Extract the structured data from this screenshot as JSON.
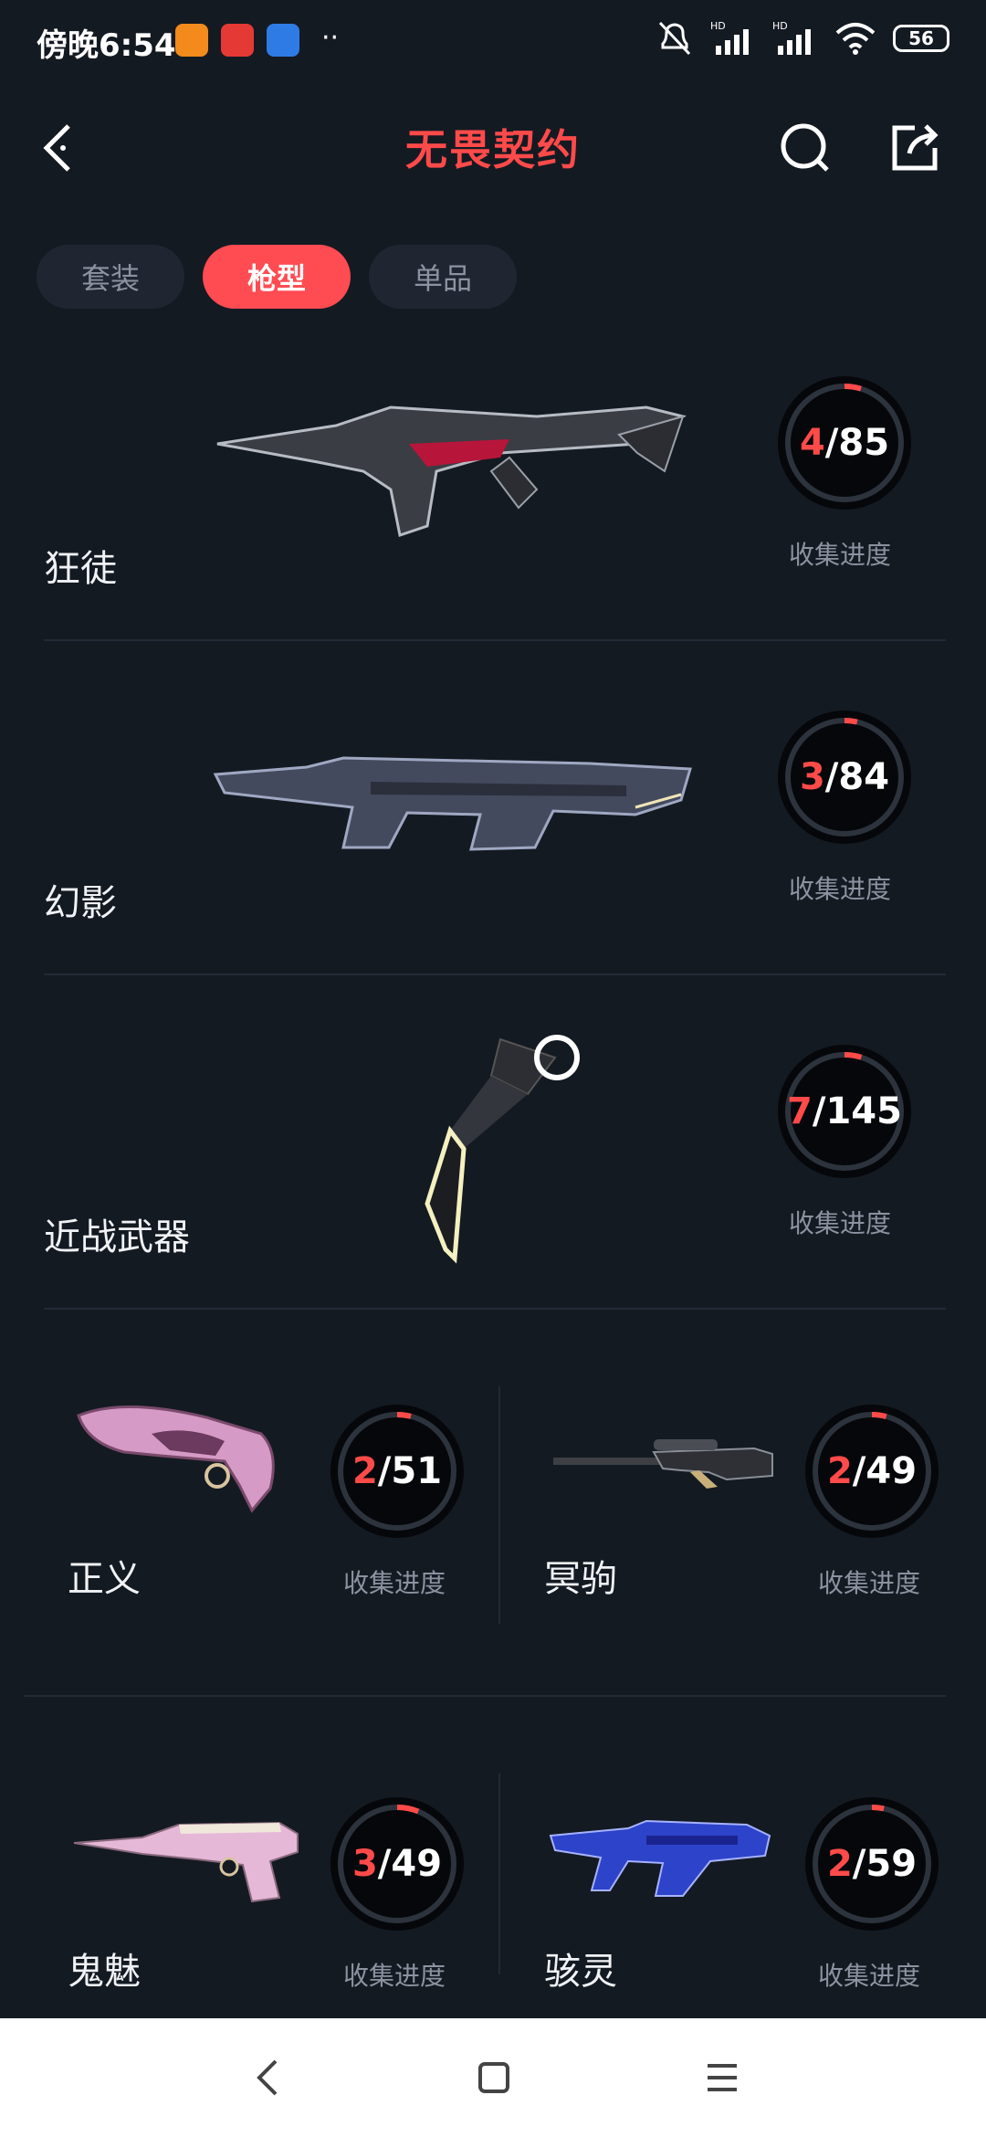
{
  "status": {
    "time": "傍晚6:54",
    "battery": "56"
  },
  "header": {
    "title": "无畏契约"
  },
  "tabs": [
    {
      "label": "套装",
      "active": false
    },
    {
      "label": "枪型",
      "active": true
    },
    {
      "label": "单品",
      "active": false
    }
  ],
  "collections": {
    "progress_label": "收集进度",
    "items": [
      {
        "name": "狂徒",
        "collected": "4",
        "total": "85",
        "progress": 0.047
      },
      {
        "name": "幻影",
        "collected": "3",
        "total": "84",
        "progress": 0.036
      },
      {
        "name": "近战武器",
        "collected": "7",
        "total": "145",
        "progress": 0.048
      },
      {
        "name": "正义",
        "collected": "2",
        "total": "51",
        "progress": 0.039
      },
      {
        "name": "冥驹",
        "collected": "2",
        "total": "49",
        "progress": 0.041
      },
      {
        "name": "鬼魅",
        "collected": "3",
        "total": "49",
        "progress": 0.061
      },
      {
        "name": "骇灵",
        "collected": "2",
        "total": "59",
        "progress": 0.034
      }
    ]
  },
  "colors": {
    "accent": "#ff4a4a",
    "background": "#141a22"
  }
}
